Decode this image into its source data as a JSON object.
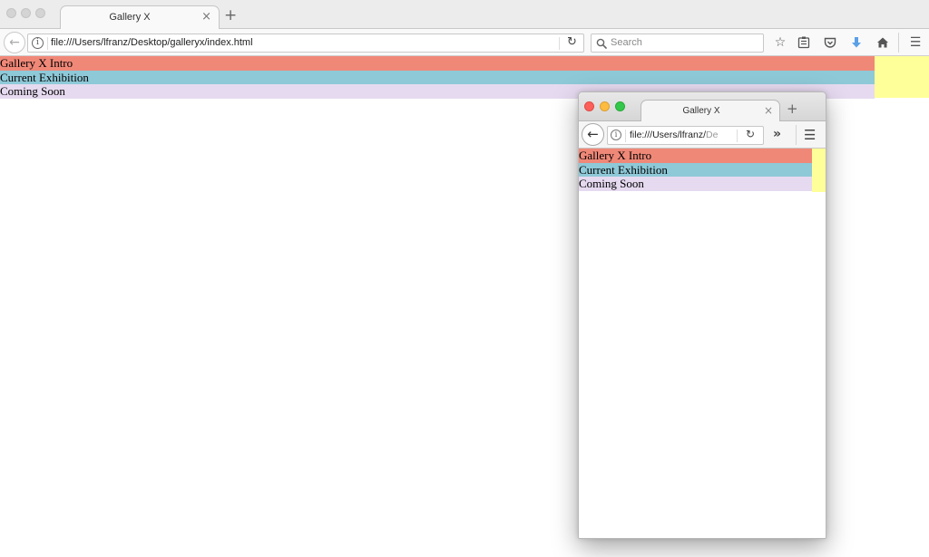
{
  "colors": {
    "intro": "#f08878",
    "current": "#8ec9d8",
    "soon": "#e6daf0",
    "aside": "#ffff99",
    "close_light": "#fc605b",
    "minimize_light": "#fdbc40",
    "zoom_light": "#34c84a",
    "download_icon": "#5aa0e6"
  },
  "main_window": {
    "tab": {
      "title": "Gallery X",
      "close_glyph": "×"
    },
    "new_tab_glyph": "+",
    "url": "file:///Users/lfranz/Desktop/galleryx/index.html",
    "search": {
      "placeholder": "Search"
    },
    "toolbar_icons": [
      "star-icon",
      "reading-list-icon",
      "pocket-icon",
      "download-icon",
      "home-icon",
      "hamburger-menu-icon"
    ]
  },
  "page": {
    "menu": [
      {
        "label": "Gallery X Intro",
        "color_key": "intro"
      },
      {
        "label": "Current Exhibition",
        "color_key": "current"
      },
      {
        "label": "Coming Soon",
        "color_key": "soon"
      }
    ]
  },
  "mini_window": {
    "tab": {
      "title": "Gallery X",
      "close_glyph": "×"
    },
    "new_tab_glyph": "+",
    "url_dark": "file:///Users/lfranz/",
    "url_faded": "De",
    "overflow_glyph": "»",
    "menu": [
      {
        "label": "Gallery X Intro"
      },
      {
        "label": "Current Exhibition"
      },
      {
        "label": "Coming Soon"
      }
    ]
  }
}
